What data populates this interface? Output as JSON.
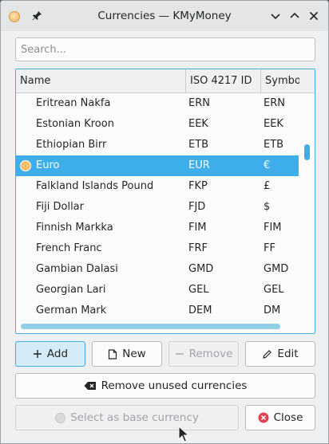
{
  "window": {
    "title": "Currencies — KMyMoney"
  },
  "titlebar": {
    "app_icon": "kmymoney-coin-icon",
    "pin_icon": "pin-icon",
    "buttons": [
      "chevron-down-icon",
      "chevron-up-icon",
      "close-icon"
    ]
  },
  "search": {
    "placeholder": "Search...",
    "value": ""
  },
  "table": {
    "columns": [
      "Name",
      "ISO 4217 ID",
      "Symbo"
    ],
    "rows": [
      {
        "name": "Eritrean Nakfa",
        "iso": "ERN",
        "symbol": "ERN",
        "selected": false
      },
      {
        "name": "Estonian Kroon",
        "iso": "EEK",
        "symbol": "EEK",
        "selected": false
      },
      {
        "name": "Ethiopian Birr",
        "iso": "ETB",
        "symbol": "ETB",
        "selected": false
      },
      {
        "name": "Euro",
        "iso": "EUR",
        "symbol": "€",
        "selected": true,
        "icon": "base-currency-coin-icon"
      },
      {
        "name": "Falkland Islands Pound",
        "iso": "FKP",
        "symbol": "£",
        "selected": false
      },
      {
        "name": "Fiji Dollar",
        "iso": "FJD",
        "symbol": "$",
        "selected": false
      },
      {
        "name": "Finnish Markka",
        "iso": "FIM",
        "symbol": "FIM",
        "selected": false
      },
      {
        "name": "French Franc",
        "iso": "FRF",
        "symbol": "FF",
        "selected": false
      },
      {
        "name": "Gambian Dalasi",
        "iso": "GMD",
        "symbol": "GMD",
        "selected": false
      },
      {
        "name": "Georgian Lari",
        "iso": "GEL",
        "symbol": "GEL",
        "selected": false
      },
      {
        "name": "German Mark",
        "iso": "DEM",
        "symbol": "DM",
        "selected": false
      }
    ]
  },
  "buttons": {
    "add": "Add",
    "new": "New",
    "remove": "Remove",
    "edit": "Edit",
    "remove_unused": "Remove unused currencies",
    "select_base": "Select as base currency",
    "close": "Close"
  },
  "colors": {
    "accent": "#3daee9",
    "window_bg": "#eff0f1",
    "close_icon": "#da4453"
  }
}
